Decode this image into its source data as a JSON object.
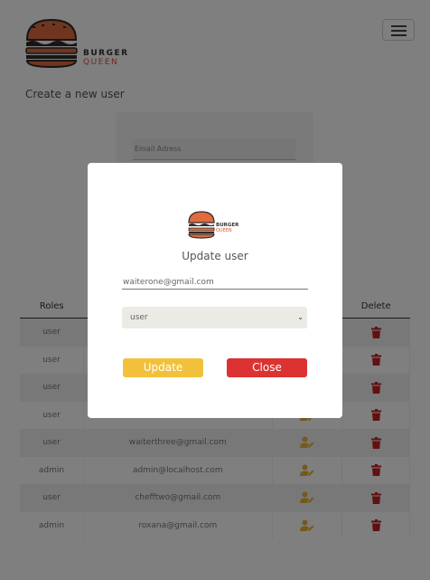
{
  "brand": {
    "line1": "BURGER",
    "line2": "QUEEN"
  },
  "page": {
    "title": "Create a new user"
  },
  "create_form": {
    "email_placeholder": "Email Adress"
  },
  "table": {
    "headers": [
      "Roles",
      "",
      "",
      "Delete"
    ],
    "rows": [
      {
        "role": "user",
        "email": ""
      },
      {
        "role": "user",
        "email": ""
      },
      {
        "role": "user",
        "email": ""
      },
      {
        "role": "user",
        "email": ""
      },
      {
        "role": "user",
        "email": "waiterthree@gmail.com"
      },
      {
        "role": "admin",
        "email": "admin@localhost.com"
      },
      {
        "role": "user",
        "email": "chefftwo@gmail.com"
      },
      {
        "role": "admin",
        "email": "roxana@gmail.com"
      }
    ],
    "edit_icon": "user-edit-icon",
    "delete_icon": "trash-icon"
  },
  "modal": {
    "title": "Update user",
    "email_value": "waiterone@gmail.com",
    "role_selected": "user",
    "update_label": "Update",
    "close_label": "Close"
  },
  "colors": {
    "accent_yellow": "#f2c13c",
    "danger_red": "#dc3232",
    "brand_orange": "#e0552c"
  }
}
